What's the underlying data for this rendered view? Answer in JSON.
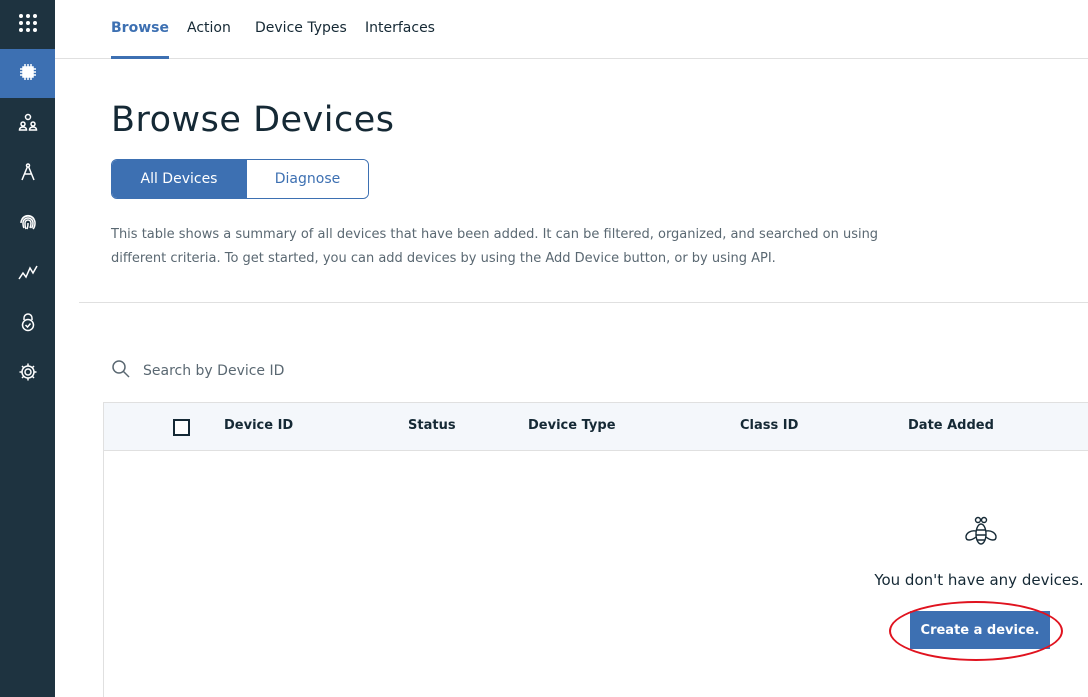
{
  "colors": {
    "sidebar_bg": "#1e3340",
    "accent": "#3d70b2",
    "annotation_ring": "#e0131f"
  },
  "sidebar": {
    "items": [
      {
        "icon": "app-grid-icon",
        "active": false
      },
      {
        "icon": "chip-icon",
        "active": true
      },
      {
        "icon": "members-icon",
        "active": false
      },
      {
        "icon": "compass-icon",
        "active": false
      },
      {
        "icon": "fingerprint-icon",
        "active": false
      },
      {
        "icon": "usage-chart-icon",
        "active": false
      },
      {
        "icon": "security-lock-icon",
        "active": false
      },
      {
        "icon": "gear-icon",
        "active": false
      }
    ]
  },
  "topnav": {
    "tabs": [
      {
        "label": "Browse",
        "active": true
      },
      {
        "label": "Action",
        "active": false
      },
      {
        "label": "Device Types",
        "active": false
      },
      {
        "label": "Interfaces",
        "active": false
      }
    ]
  },
  "page": {
    "title": "Browse Devices",
    "segments": [
      "All Devices",
      "Diagnose"
    ],
    "selected_segment": "All Devices",
    "description": "This table shows a summary of all devices that have been added. It can be filtered, organized, and searched on using different criteria. To get started, you can add devices by using the Add Device button, or by using API."
  },
  "search": {
    "placeholder": "Search by Device ID",
    "icon": "search-icon"
  },
  "table": {
    "columns": [
      "Device ID",
      "Status",
      "Device Type",
      "Class ID",
      "Date Added"
    ],
    "rows": []
  },
  "empty_state": {
    "icon": "bee-icon",
    "message": "You don't have any devices.",
    "button_label": "Create a device."
  }
}
